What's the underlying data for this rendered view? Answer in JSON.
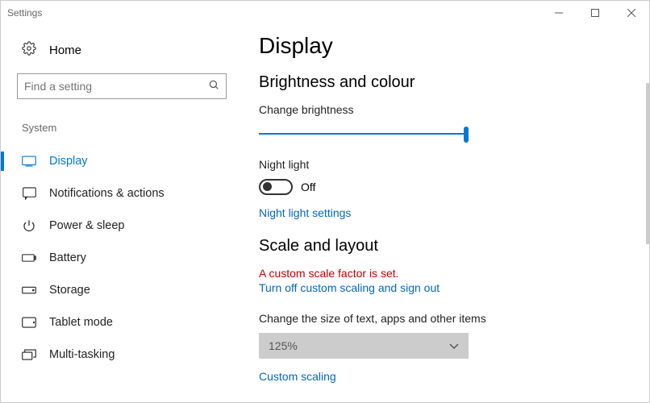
{
  "window": {
    "title": "Settings"
  },
  "sidebar": {
    "home": "Home",
    "search_placeholder": "Find a setting",
    "group_label": "System",
    "items": [
      {
        "label": "Display"
      },
      {
        "label": "Notifications & actions"
      },
      {
        "label": "Power & sleep"
      },
      {
        "label": "Battery"
      },
      {
        "label": "Storage"
      },
      {
        "label": "Tablet mode"
      },
      {
        "label": "Multi-tasking"
      }
    ]
  },
  "main": {
    "title": "Display",
    "section1": {
      "heading": "Brightness and colour",
      "brightness_label": "Change brightness",
      "brightness_value": 100,
      "night_light_label": "Night light",
      "night_light_state": "Off",
      "night_light_settings_link": "Night light settings"
    },
    "section2": {
      "heading": "Scale and layout",
      "warning": "A custom scale factor is set.",
      "turn_off_link": "Turn off custom scaling and sign out",
      "size_label": "Change the size of text, apps and other items",
      "size_value": "125%",
      "custom_scaling_link": "Custom scaling"
    }
  }
}
